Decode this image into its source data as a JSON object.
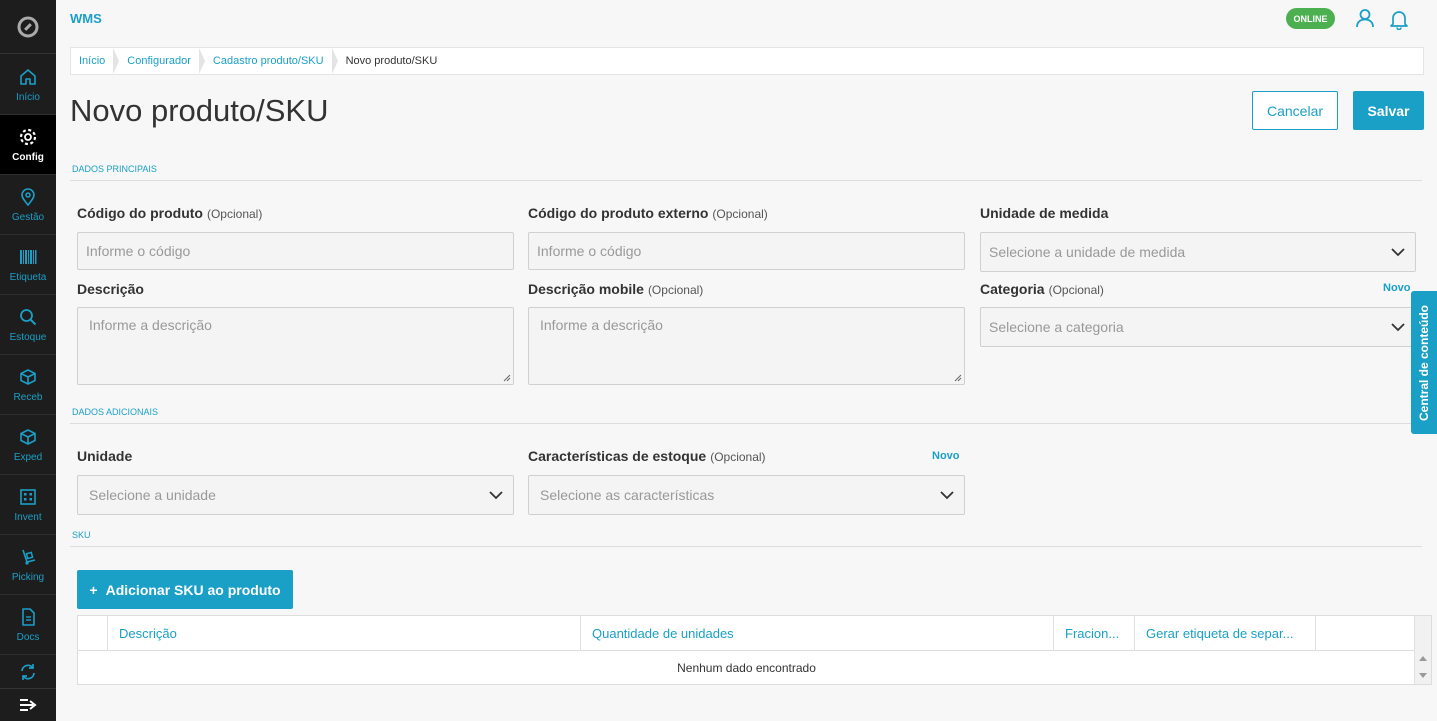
{
  "app": {
    "title": "WMS",
    "status": "ONLINE"
  },
  "sidebar": {
    "items": [
      {
        "label": "Início",
        "icon": "home-icon"
      },
      {
        "label": "Config",
        "icon": "gear-icon",
        "active": true
      },
      {
        "label": "Gestão",
        "icon": "location-pin-icon"
      },
      {
        "label": "Etiqueta",
        "icon": "barcode-icon"
      },
      {
        "label": "Estoque",
        "icon": "search-icon"
      },
      {
        "label": "Receb",
        "icon": "box-icon"
      },
      {
        "label": "Exped",
        "icon": "box-icon"
      },
      {
        "label": "Invent",
        "icon": "building-icon"
      },
      {
        "label": "Picking",
        "icon": "hand-truck-icon"
      },
      {
        "label": "Docs",
        "icon": "document-icon"
      },
      {
        "label": "",
        "icon": "sync-icon"
      }
    ]
  },
  "breadcrumb": [
    "Início",
    "Configurador",
    "Cadastro produto/SKU",
    "Novo produto/SKU"
  ],
  "page": {
    "title": "Novo produto/SKU"
  },
  "actions": {
    "cancel": "Cancelar",
    "save": "Salvar"
  },
  "sections": {
    "main": "DADOS PRINCIPAIS",
    "extra": "DADOS ADICIONAIS",
    "sku": "SKU"
  },
  "fields": {
    "codigo": {
      "label": "Código do produto",
      "optional": "(Opcional)",
      "placeholder": "Informe o código"
    },
    "codigo_externo": {
      "label": "Código do produto externo",
      "optional": "(Opcional)",
      "placeholder": "Informe o código"
    },
    "unidade_medida": {
      "label": "Unidade de medida",
      "placeholder": "Selecione a unidade de medida"
    },
    "descricao": {
      "label": "Descrição",
      "placeholder": "Informe a descrição"
    },
    "descricao_mobile": {
      "label": "Descrição mobile",
      "optional": "(Opcional)",
      "placeholder": "Informe a descrição"
    },
    "categoria": {
      "label": "Categoria",
      "optional": "(Opcional)",
      "placeholder": "Selecione a categoria",
      "new_link": "Novo"
    },
    "unidade": {
      "label": "Unidade",
      "placeholder": "Selecione a unidade"
    },
    "caracteristicas": {
      "label": "Características de estoque",
      "optional": "(Opcional)",
      "placeholder": "Selecione as características",
      "new_link": "Novo"
    }
  },
  "sku": {
    "add_button": "Adicionar SKU ao produto",
    "columns": [
      "",
      "Descrição",
      "Quantidade de unidades",
      "Fracion...",
      "Gerar etiqueta de separ...",
      ""
    ],
    "empty_text": "Nenhum dado encontrado"
  },
  "side_tab": "Central de conteúdo",
  "colors": {
    "accent": "#1a9fc7",
    "sidebar": "#1d1d1d",
    "online": "#4caf50"
  }
}
